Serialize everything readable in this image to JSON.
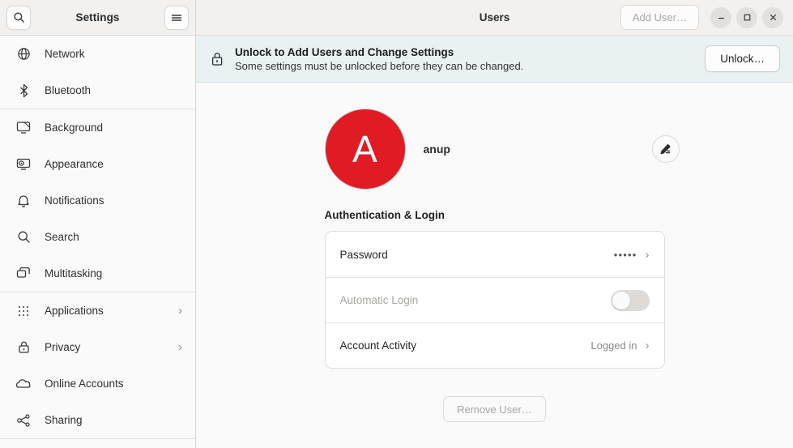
{
  "sidebar": {
    "title": "Settings",
    "search_icon": "search-icon",
    "menu_icon": "hamburger-menu-icon",
    "items": [
      {
        "label": "Network",
        "icon": "network-globe-icon",
        "chevron": "",
        "sep_after": false
      },
      {
        "label": "Bluetooth",
        "icon": "bluetooth-icon",
        "chevron": "",
        "sep_after": true
      },
      {
        "label": "Background",
        "icon": "background-icon",
        "chevron": "",
        "sep_after": false
      },
      {
        "label": "Appearance",
        "icon": "appearance-icon",
        "chevron": "",
        "sep_after": false
      },
      {
        "label": "Notifications",
        "icon": "bell-icon",
        "chevron": "",
        "sep_after": false
      },
      {
        "label": "Search",
        "icon": "search-icon",
        "chevron": "",
        "sep_after": false
      },
      {
        "label": "Multitasking",
        "icon": "multitasking-icon",
        "chevron": "",
        "sep_after": true
      },
      {
        "label": "Applications",
        "icon": "applications-grid-icon",
        "chevron": "›",
        "sep_after": false
      },
      {
        "label": "Privacy",
        "icon": "lock-icon",
        "chevron": "›",
        "sep_after": false
      },
      {
        "label": "Online Accounts",
        "icon": "cloud-icon",
        "chevron": "",
        "sep_after": false
      },
      {
        "label": "Sharing",
        "icon": "share-nodes-icon",
        "chevron": "",
        "sep_after": true
      }
    ]
  },
  "titlebar": {
    "title": "Users",
    "add_user_label": "Add User…",
    "add_user_enabled": false,
    "minimize_glyph": "–",
    "maximize_glyph": "□",
    "close_glyph": "×"
  },
  "banner": {
    "icon": "padlock-icon",
    "title": "Unlock to Add Users and Change Settings",
    "subtitle": "Some settings must be unlocked before they can be changed.",
    "button_label": "Unlock…",
    "background_color": "#e9f1f3"
  },
  "user": {
    "avatar_letter": "A",
    "avatar_color": "#e01b24",
    "name": "anup",
    "edit_icon": "pencil-edit-icon"
  },
  "auth_section": {
    "title": "Authentication & Login",
    "rows": [
      {
        "label": "Password",
        "value": "•••••",
        "type": "chevron",
        "chevron": "›",
        "disabled": false
      },
      {
        "label": "Automatic Login",
        "value": "",
        "type": "toggle",
        "chevron": "",
        "disabled": true,
        "toggle_on": false
      },
      {
        "label": "Account Activity",
        "value": "Logged in",
        "type": "chevron",
        "chevron": "›",
        "disabled": false
      }
    ]
  },
  "footer": {
    "remove_user_label": "Remove User…",
    "remove_user_enabled": false
  }
}
